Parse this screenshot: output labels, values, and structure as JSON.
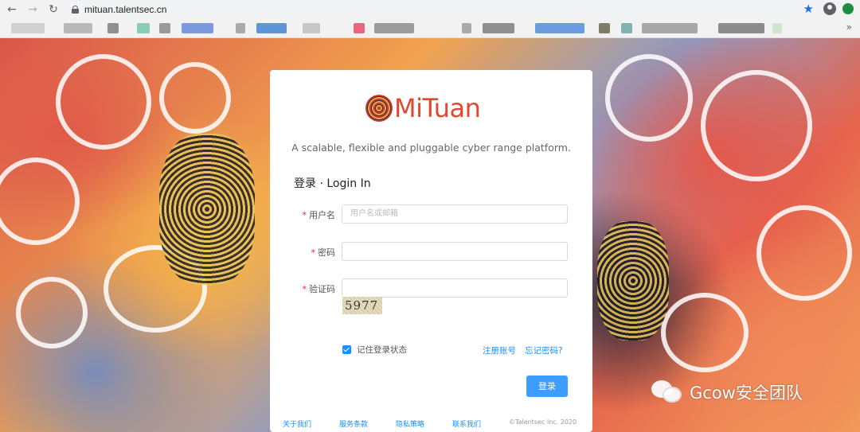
{
  "browser": {
    "url": "mituan.talentsec.cn",
    "back_icon": "arrow-left-icon",
    "forward_icon": "arrow-right-icon",
    "reload_icon": "reload-icon",
    "bookmark_icon": "star-icon",
    "more_bookmarks": "»"
  },
  "card": {
    "logo_text": "MiTuan",
    "tagline": "A scalable, flexible and pluggable cyber range platform.",
    "form_title": "登录 · Login In",
    "required_mark": "*",
    "username_label": "用户名",
    "username_placeholder": "用户名或邮箱",
    "password_label": "密码",
    "captcha_label": "验证码",
    "captcha_text": "5977",
    "remember_label": "记住登录状态",
    "register_link": "注册账号",
    "forgot_link": "忘记密码?",
    "login_button": "登录",
    "footer": {
      "about": "关于我们",
      "terms": "服务条款",
      "privacy": "隐私策略",
      "contact": "联系我们",
      "copyright": "©Talentsec Inc. 2020"
    }
  },
  "watermark": {
    "text": "Gcow安全团队"
  },
  "colors": {
    "brand_red": "#e0482f",
    "link_blue": "#1890ff",
    "button_blue": "#3d9eff",
    "required_red": "#f5222d"
  }
}
